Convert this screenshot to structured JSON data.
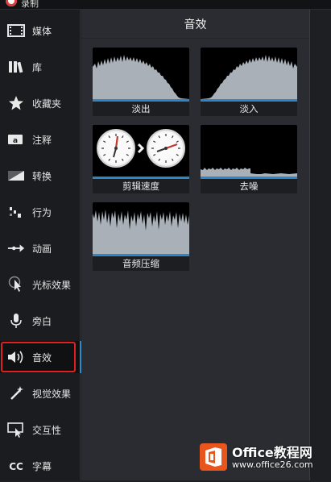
{
  "window": {
    "title_fragment": "录制"
  },
  "sidebar": {
    "items": [
      {
        "label": "媒体",
        "icon": "film-strip-icon"
      },
      {
        "label": "库",
        "icon": "library-books-icon"
      },
      {
        "label": "收藏夹",
        "icon": "star-icon"
      },
      {
        "label": "注释",
        "icon": "annotation-icon"
      },
      {
        "label": "转换",
        "icon": "transition-icon"
      },
      {
        "label": "行为",
        "icon": "behavior-icon"
      },
      {
        "label": "动画",
        "icon": "animation-arrow-icon"
      },
      {
        "label": "光标效果",
        "icon": "cursor-effect-icon"
      },
      {
        "label": "旁白",
        "icon": "microphone-icon"
      },
      {
        "label": "音效",
        "icon": "speaker-icon"
      },
      {
        "label": "视觉效果",
        "icon": "magic-wand-icon"
      },
      {
        "label": "交互性",
        "icon": "interactive-icon"
      },
      {
        "label": "字幕",
        "icon": "cc-icon"
      }
    ],
    "active_index": 9
  },
  "main": {
    "title": "音效",
    "effects": [
      {
        "name": "淡出"
      },
      {
        "name": "淡入"
      },
      {
        "name": "剪辑速度"
      },
      {
        "name": "去噪"
      },
      {
        "name": "音频压缩"
      }
    ]
  },
  "watermark": {
    "title": "Office教程网",
    "url": "www.office26.com"
  },
  "colors": {
    "accent": "#2d86c7",
    "highlight_border": "#e02020",
    "watermark_logo": "#e8551d"
  }
}
